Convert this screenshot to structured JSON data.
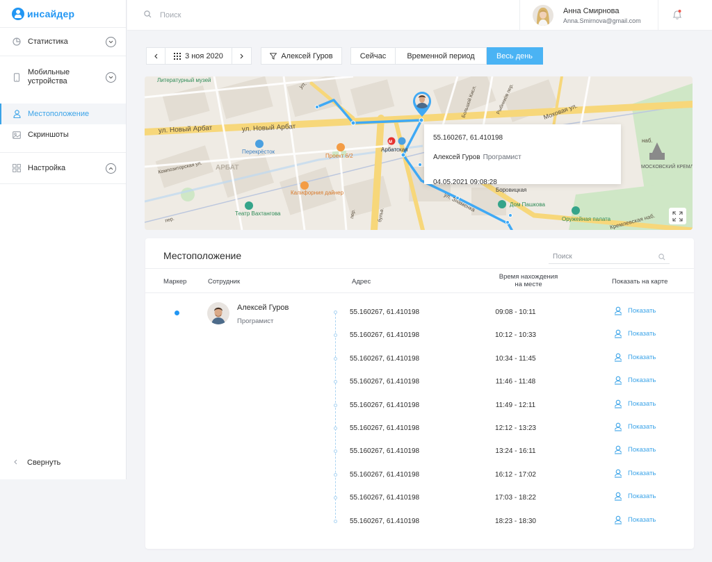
{
  "app": {
    "logo_text": "инсайдер"
  },
  "sidebar": {
    "items": [
      {
        "label": "Статистика"
      },
      {
        "label": "Мобильные устройства"
      },
      {
        "label": "Настройка"
      }
    ],
    "sub_items": [
      {
        "label": "Местоположение",
        "active": true
      },
      {
        "label": "Скриншоты",
        "active": false
      }
    ],
    "collapse_label": "Свернуть"
  },
  "header": {
    "search_placeholder": "Поиск",
    "user_name": "Анна Смирнова",
    "user_email": "Anna.Smirnova@gmail.com"
  },
  "toolbar": {
    "date": "3 ноя 2020",
    "employee_filter": "Алексей Гуров",
    "tabs": [
      "Сейчас",
      "Временной период",
      "Весь день"
    ],
    "active_tab": "Весь день"
  },
  "map": {
    "labels": {
      "street_arbat_1": "ул. Новый Арбат",
      "street_arbat_2": "ул. Новый Арбат",
      "museum": "Литературный музей",
      "perekrestok": "Перекрёсток",
      "project": "Проект 6/2",
      "arbatskaya": "Арбатская",
      "metro": "М",
      "arbat": "АРБАТ",
      "california": "Калифорния дайнер",
      "vakhtangov": "Театр Вахтангова",
      "borovitskaya": "Боровицкая",
      "pashkov": "Дом Пашкова",
      "armory": "Оружейная палата",
      "kremlin": "МОСКОВСКИЙ КРЕМЛЬ",
      "mokhovaya": "Моховая ул.",
      "kislovsky": "Большой Кисл.",
      "rybnikov": "Рыбников пер.",
      "kompozitor": "Композиторская ул.",
      "znamenka": "ул. Знаменка",
      "nab": "наб.",
      "kremlin_nab": "Кремлевская наб.",
      "bul": "бульв.",
      "per_1": "пер.",
      "per_2": "пер.",
      "ul": "ул."
    },
    "popup": {
      "coords": "55.160267, 61.410198",
      "name": "Алексей Гуров",
      "role": "Програмист",
      "datetime": "04.05.2021 09:08:28"
    }
  },
  "panel": {
    "title": "Местоположение",
    "search_placeholder": "Поиск",
    "columns": {
      "marker": "Маркер",
      "employee": "Сотрудник",
      "address": "Адрес",
      "time_line1": "Время нахождения",
      "time_line2": "на месте",
      "show": "Показать на карте"
    },
    "employee": {
      "name": "Алексей Гуров",
      "role": "Програмист"
    },
    "show_label": "Показать",
    "rows": [
      {
        "address": "55.160267, 61.410198",
        "time": "09:08 - 10:11"
      },
      {
        "address": "55.160267, 61.410198",
        "time": "10:12 - 10:33"
      },
      {
        "address": "55.160267, 61.410198",
        "time": "10:34 - 11:45"
      },
      {
        "address": "55.160267, 61.410198",
        "time": "11:46 - 11:48"
      },
      {
        "address": "55.160267, 61.410198",
        "time": "11:49 - 12:11"
      },
      {
        "address": "55.160267, 61.410198",
        "time": "12:12 - 13:23"
      },
      {
        "address": "55.160267, 61.410198",
        "time": "13:24 - 16:11"
      },
      {
        "address": "55.160267, 61.410198",
        "time": "16:12 - 17:02"
      },
      {
        "address": "55.160267, 61.410198",
        "time": "17:03 - 18:22"
      },
      {
        "address": "55.160267, 61.410198",
        "time": "18:23 - 18:30"
      }
    ]
  },
  "colors": {
    "accent": "#3aa3e8",
    "route": "#3fa9f5",
    "brand": "#2196f3"
  }
}
